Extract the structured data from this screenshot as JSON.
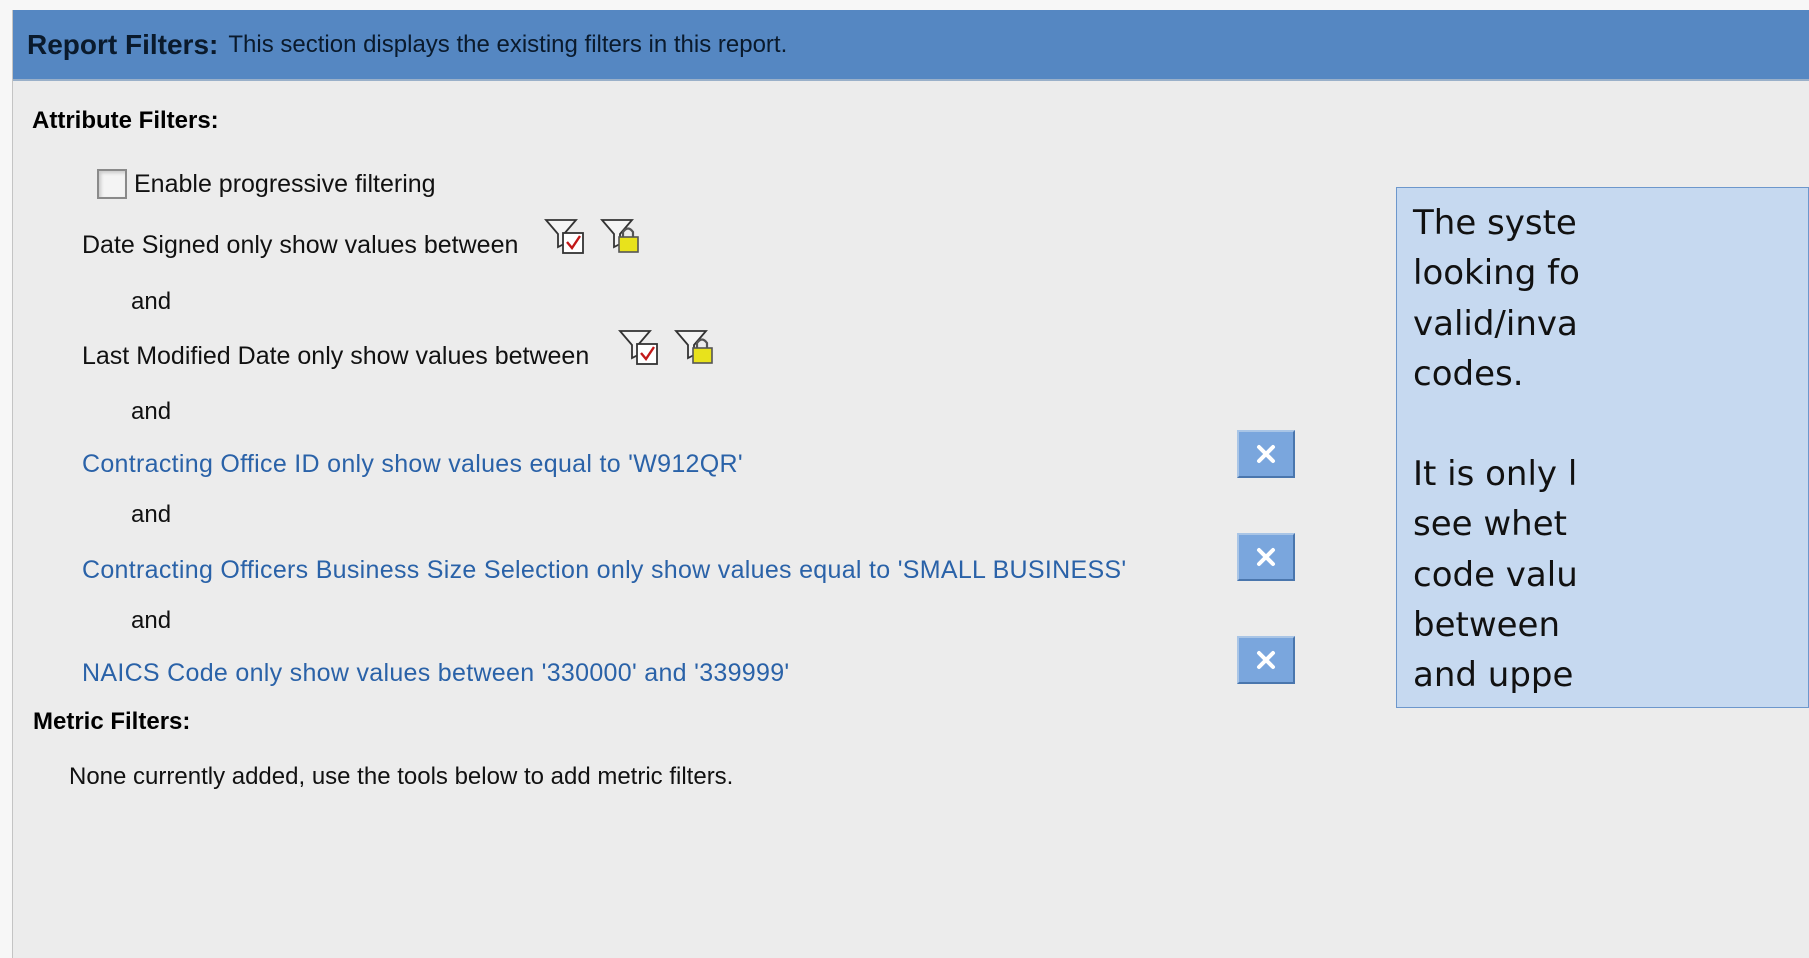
{
  "header": {
    "title": "Report Filters:",
    "description": "This section displays the existing filters in this report."
  },
  "attribute_filters": {
    "title": "Attribute Filters:",
    "progressive_checkbox": {
      "label": "Enable progressive filtering",
      "checked": false
    },
    "filters": [
      {
        "text": "Date Signed only show values between",
        "editable": false,
        "icons": [
          "filter-edit-icon",
          "filter-lock-icon"
        ]
      },
      {
        "text": "Last Modified Date only show values between",
        "editable": false,
        "icons": [
          "filter-edit-icon",
          "filter-lock-icon"
        ]
      },
      {
        "text": "Contracting Office ID only show values equal to 'W912QR'",
        "editable": true
      },
      {
        "text": "Contracting Officers Business Size Selection only show values equal to 'SMALL BUSINESS'",
        "editable": true
      },
      {
        "text": "NAICS Code only show values between '330000' and '339999'",
        "editable": true
      }
    ],
    "connector": "and"
  },
  "metric_filters": {
    "title": "Metric Filters:",
    "empty_text": "None currently added, use the tools below to add metric filters."
  },
  "callout": {
    "lines_1": [
      "The syste",
      "looking fo",
      "valid/inva",
      "codes."
    ],
    "lines_2": [
      "It is only l",
      "see whet",
      "code valu",
      "between",
      "and uppe"
    ]
  },
  "colors": {
    "header_bg": "#5587c2",
    "link": "#2a62a8",
    "remove_button": "#7aa6dd",
    "callout_bg": "#c6d9f0",
    "panel_bg": "#ececec"
  }
}
